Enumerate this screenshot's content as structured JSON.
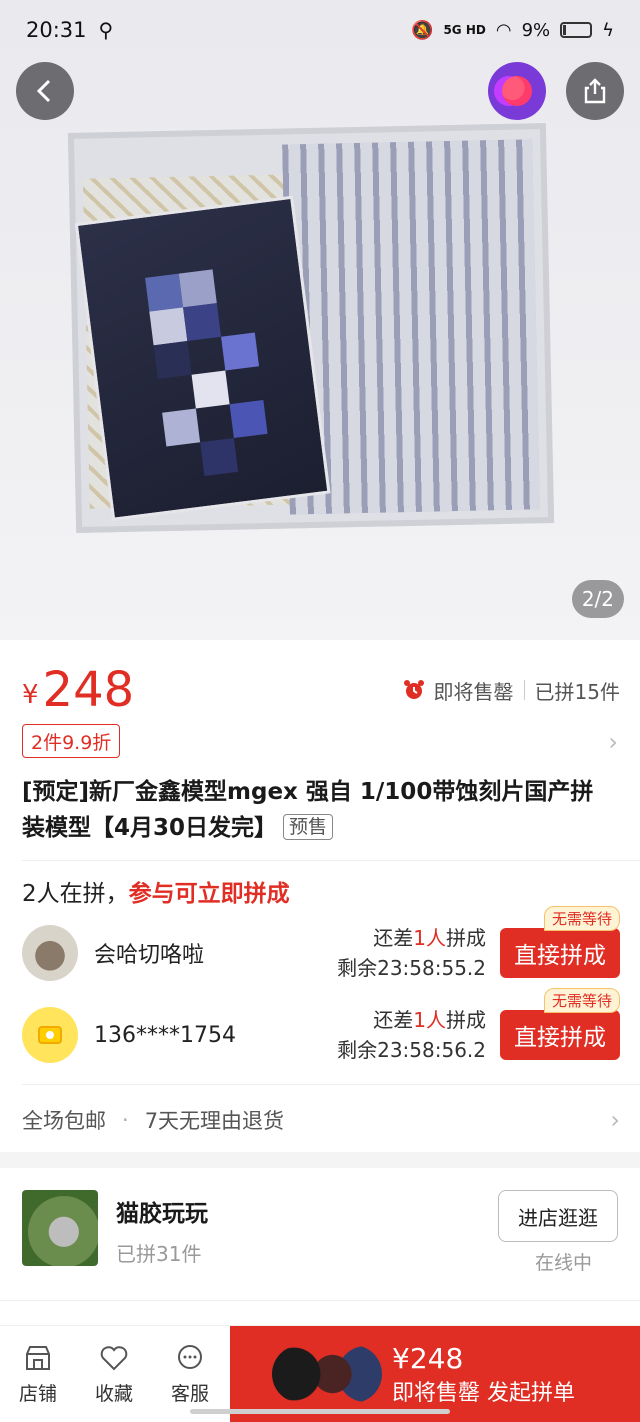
{
  "status_bar": {
    "time": "20:31",
    "usb_icon": "usb-icon",
    "network": "5G HD",
    "battery": "9%"
  },
  "gallery": {
    "counter": "2/2"
  },
  "price": {
    "currency": "¥",
    "amount": "248",
    "sale_status": "即将售罄",
    "joined_count": "已拼15件",
    "discount": "2件9.9折"
  },
  "product": {
    "title": "[预定]新厂金鑫模型mgex 强自 1/100带蚀刻片国产拼装模型【4月30日发完】",
    "tag": "预售"
  },
  "group": {
    "head_left": "2人在拼，",
    "head_right": "参与可立即拼成",
    "rows": [
      {
        "name": "会哈切咯啦",
        "need_prefix": "还差",
        "need_num": "1人",
        "need_suffix": "拼成",
        "remaining": "剩余23:58:55.2",
        "button": "直接拼成",
        "badge": "无需等待"
      },
      {
        "name": "136****1754",
        "need_prefix": "还差",
        "need_num": "1人",
        "need_suffix": "拼成",
        "remaining": "剩余23:58:56.2",
        "button": "直接拼成",
        "badge": "无需等待"
      }
    ]
  },
  "service": {
    "item1": "全场包邮",
    "dot": "·",
    "item2": "7天无理由退货"
  },
  "shop": {
    "name": "猫胶玩玩",
    "sold": "已拼31件",
    "button": "进店逛逛",
    "online": "在线中"
  },
  "bottom_bar": {
    "items": [
      {
        "label": "店铺",
        "icon": "store-icon"
      },
      {
        "label": "收藏",
        "icon": "heart-icon"
      },
      {
        "label": "客服",
        "icon": "chat-icon"
      }
    ],
    "cta_price": "¥248",
    "cta_label": "即将售罄 发起拼单"
  },
  "colors": {
    "accent": "#e02e24"
  }
}
